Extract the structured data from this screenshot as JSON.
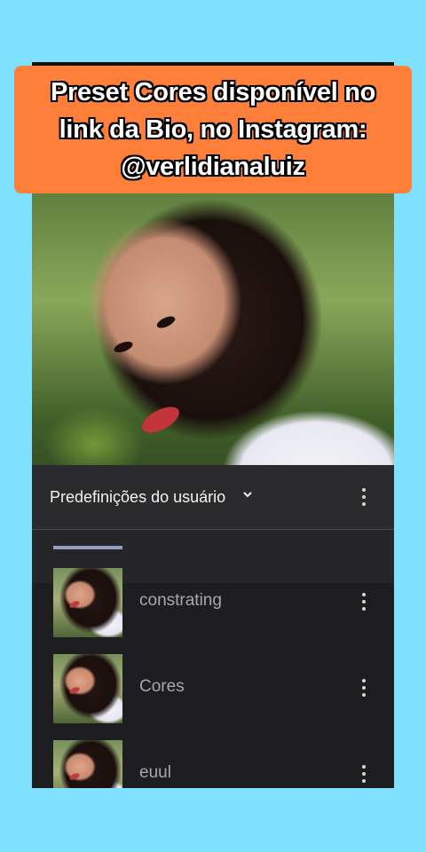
{
  "banner": {
    "line1": "Preset Cores disponível no",
    "line2": "link da Bio, no Instagram:",
    "line3": "@verlidianaluiz"
  },
  "panel": {
    "title": "Predefinições do usuário",
    "icons": {
      "dropdown": "chevron-down-icon",
      "menu": "more-vertical-icon"
    }
  },
  "presets": [
    {
      "label": "constrating"
    },
    {
      "label": "Cores"
    },
    {
      "label": "euul"
    }
  ]
}
